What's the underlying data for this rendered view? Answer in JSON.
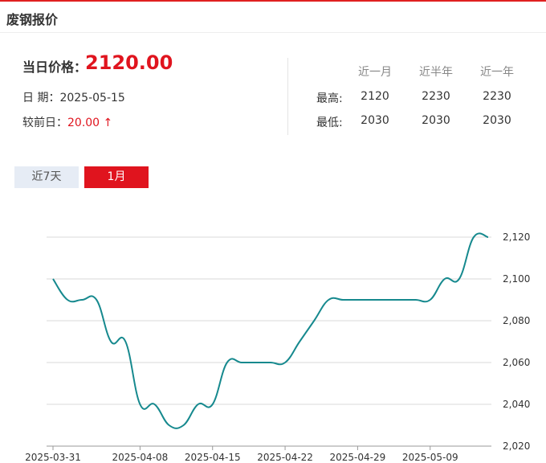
{
  "header": {
    "title": "废钢报价"
  },
  "price": {
    "label": "当日价格：",
    "value": "2120.00"
  },
  "date": {
    "label": "日 期：",
    "value": "2025-05-15"
  },
  "prev": {
    "label": "较前日：",
    "change": "20.00",
    "arrow": "↑"
  },
  "stats": {
    "columns": [
      "近一月",
      "近半年",
      "近一年"
    ],
    "rows": [
      {
        "label": "最高:",
        "values": [
          "2120",
          "2230",
          "2230"
        ]
      },
      {
        "label": "最低:",
        "values": [
          "2030",
          "2030",
          "2030"
        ]
      }
    ]
  },
  "tabs": {
    "seven_days": "近7天",
    "one_month": "1月",
    "active": "one_month"
  },
  "colors": {
    "accent": "#e0141e",
    "line": "#16898e",
    "grid": "#d9d9d9"
  },
  "chart_data": {
    "type": "line",
    "x": [
      "2025-03-31",
      "2025-04-01",
      "2025-04-02",
      "2025-04-03",
      "2025-04-04",
      "2025-04-07",
      "2025-04-08",
      "2025-04-09",
      "2025-04-10",
      "2025-04-11",
      "2025-04-14",
      "2025-04-15",
      "2025-04-16",
      "2025-04-17",
      "2025-04-18",
      "2025-04-21",
      "2025-04-22",
      "2025-04-23",
      "2025-04-24",
      "2025-04-25",
      "2025-04-28",
      "2025-04-29",
      "2025-04-30",
      "2025-05-06",
      "2025-05-07",
      "2025-05-08",
      "2025-05-09",
      "2025-05-12",
      "2025-05-13",
      "2025-05-14",
      "2025-05-15"
    ],
    "series": [
      {
        "values": [
          2100,
          2090,
          2090,
          2090,
          2070,
          2070,
          2040,
          2040,
          2030,
          2030,
          2040,
          2040,
          2060,
          2060,
          2060,
          2060,
          2060,
          2070,
          2080,
          2090,
          2090,
          2090,
          2090,
          2090,
          2090,
          2090,
          2090,
          2100,
          2100,
          2120,
          2120
        ]
      }
    ],
    "ylim": [
      2020,
      2120
    ],
    "yticks": [
      2020,
      2040,
      2060,
      2080,
      2100,
      2120
    ],
    "ytick_labels": [
      "2,020",
      "2,040",
      "2,060",
      "2,080",
      "2,100",
      "2,120"
    ],
    "xtick_labels": [
      "2025-03-31",
      "2025-04-08",
      "2025-04-15",
      "2025-04-22",
      "2025-04-29",
      "2025-05-09"
    ],
    "grid": true,
    "title": "",
    "xlabel": "",
    "ylabel": ""
  }
}
